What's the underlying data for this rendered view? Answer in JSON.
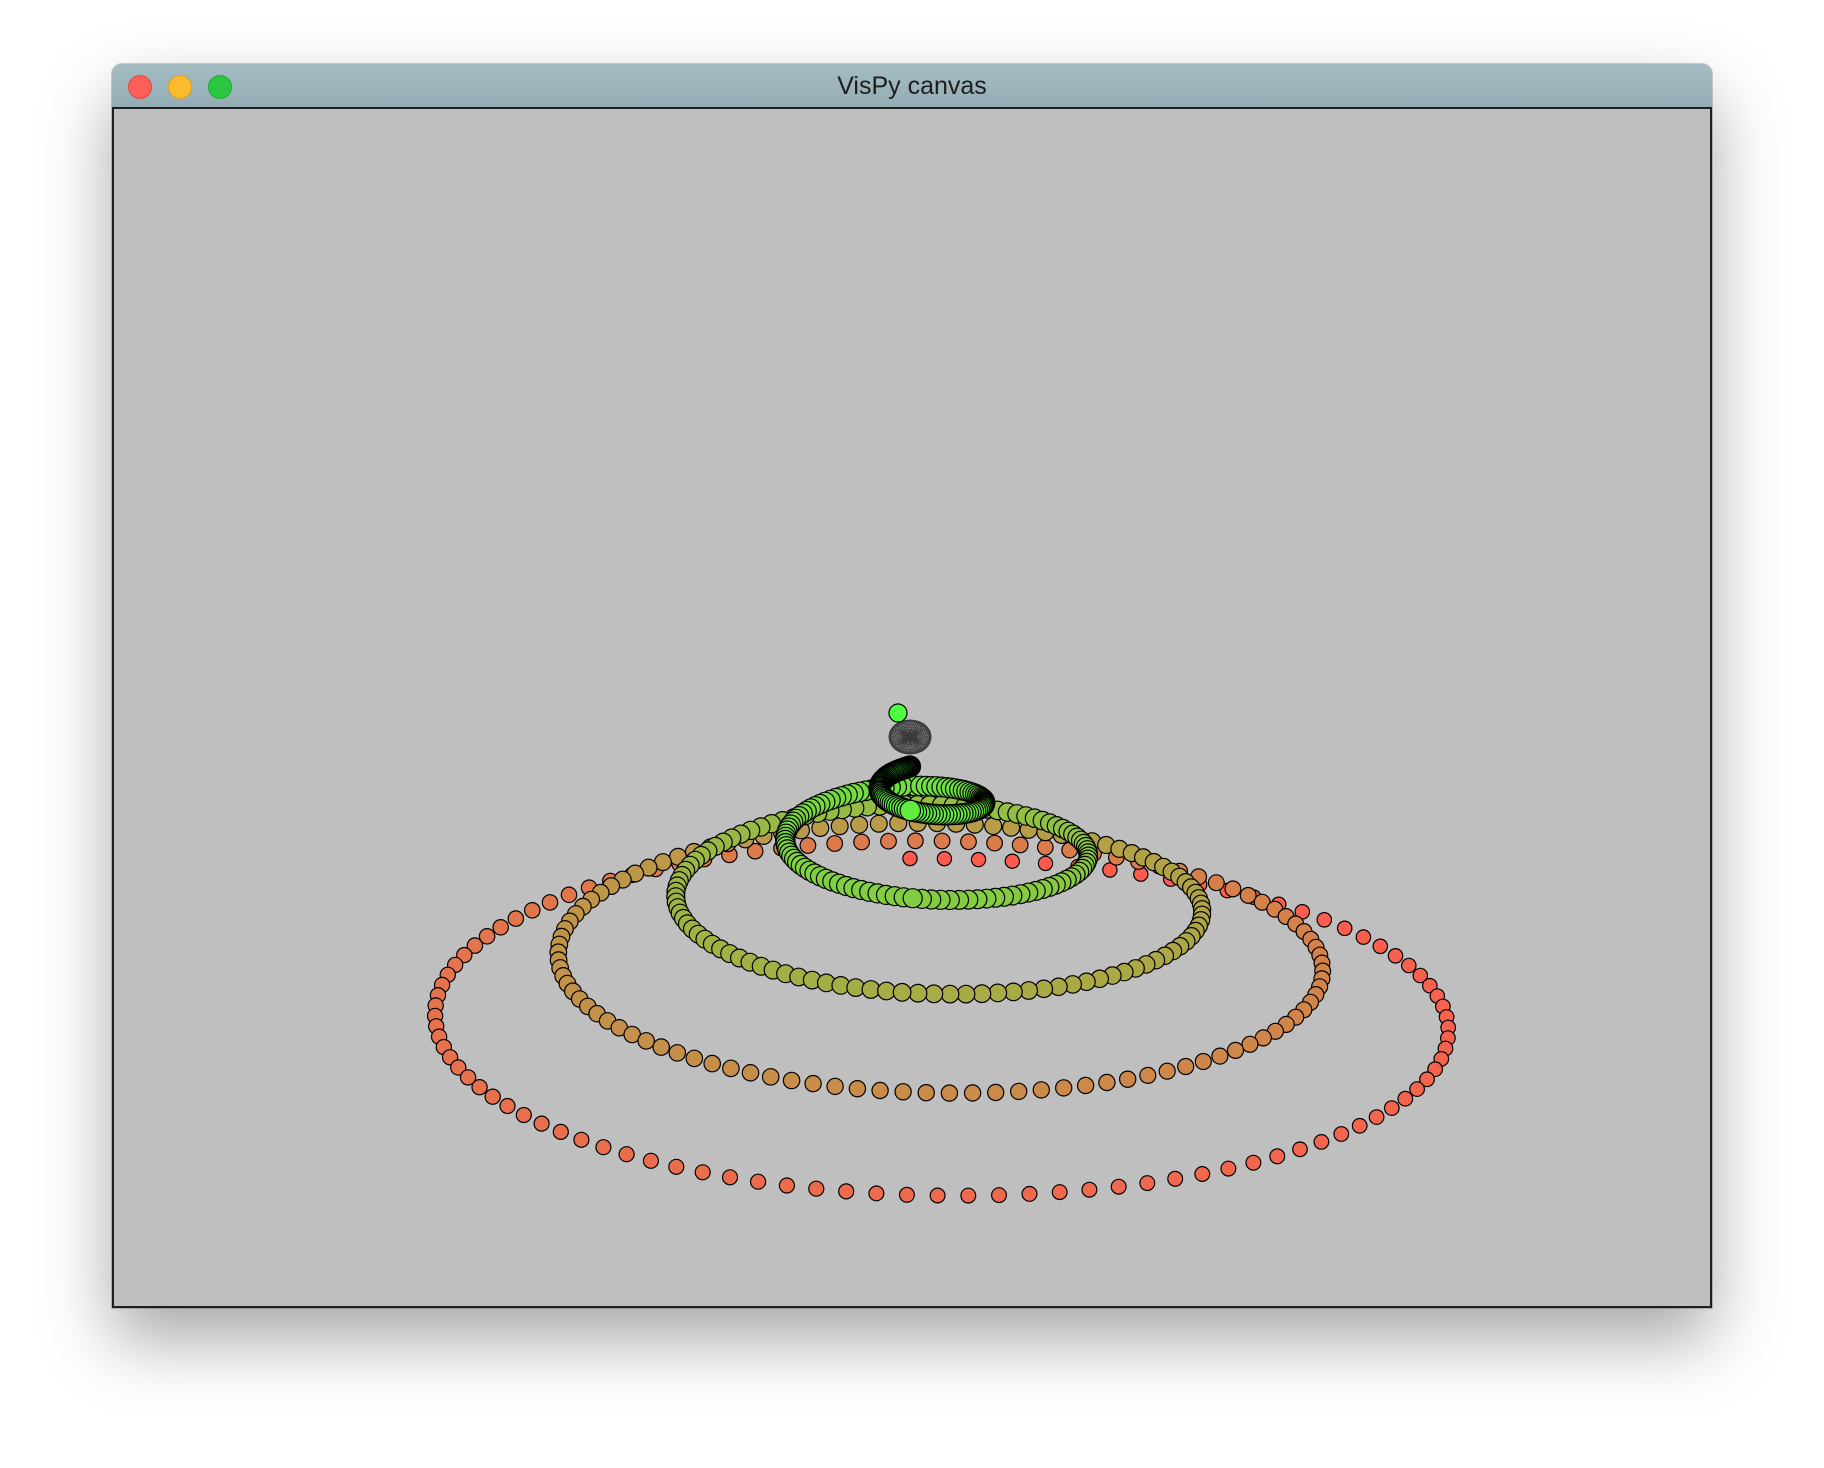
{
  "window": {
    "title": "VisPy canvas",
    "background_color": "#bfbfbf",
    "titlebar_colors": [
      "#a4bcc2",
      "#94acb3"
    ],
    "controls": {
      "close_color": "#fc5f57",
      "minimize_color": "#fdbc2e",
      "zoom_color": "#2ac840"
    }
  },
  "scene": {
    "description_type": "3d-marker-helix",
    "marker_shape": "circle",
    "marker_edge_color": "#000000",
    "color_ramp": {
      "start": "#ff5a4e",
      "end": "#4dff3e"
    }
  }
}
